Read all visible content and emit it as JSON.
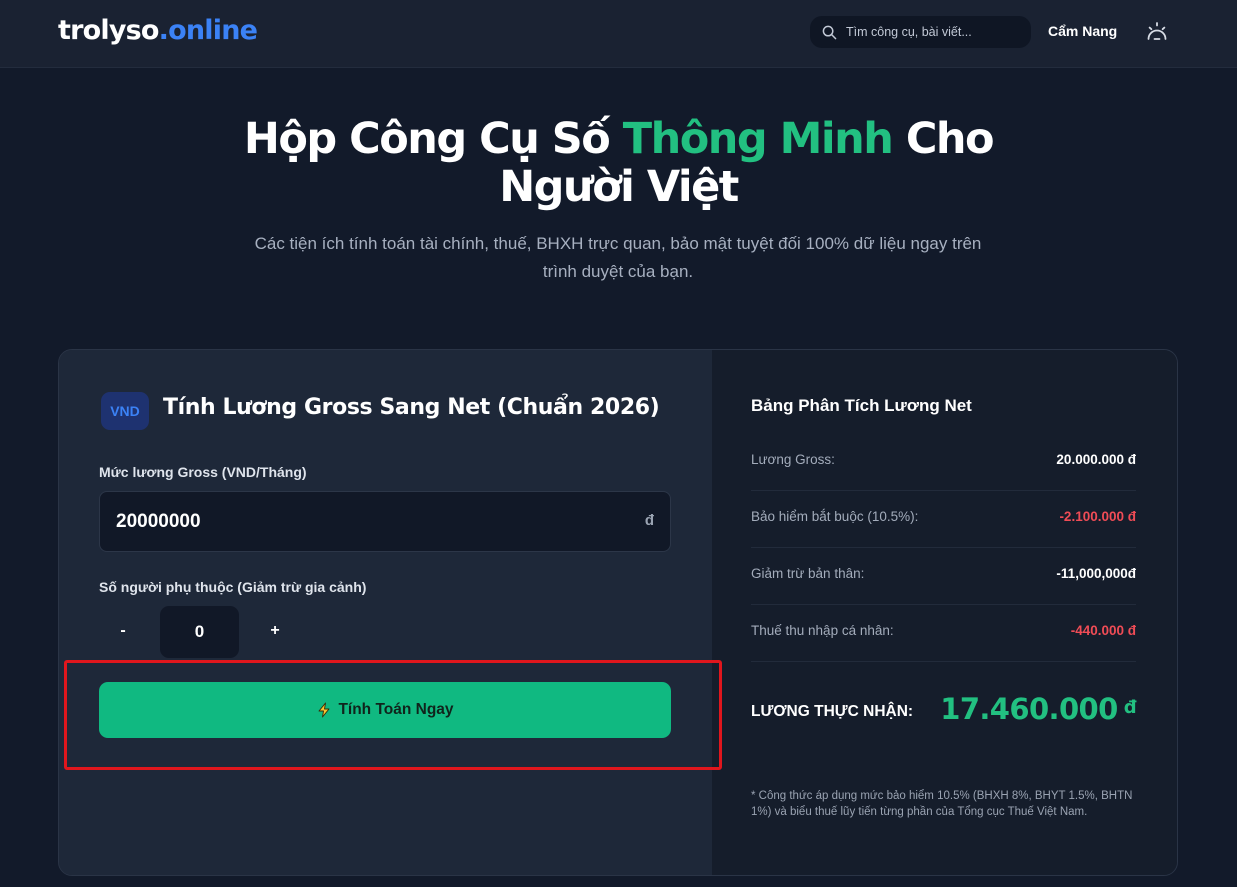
{
  "header": {
    "logo_part1": "trolyso",
    "logo_part2": ".online",
    "search_placeholder": "Tìm công cụ, bài viết...",
    "nav_link": "Cẩm Nang",
    "icons": [
      "search-icon",
      "theme-toggle-icon"
    ]
  },
  "hero": {
    "title_part1": "Hộp Công Cụ Số ",
    "title_highlight": "Thông Minh",
    "title_part2": " Cho",
    "title_line2": "Người Việt",
    "subtitle_line1": "Các tiện ích tính toán tài chính, thuế, BHXH trực quan, bảo mật tuyệt đối 100% dữ liệu ngay trên",
    "subtitle_line2": "trình duyệt của bạn."
  },
  "calculator": {
    "badge": "VND",
    "title": "Tính Lương Gross Sang Net (Chuẩn 2026)",
    "gross_label": "Mức lương Gross (VND/Tháng)",
    "gross_value": "20000000",
    "currency_symbol": "đ",
    "dependents_label": "Số người phụ thuộc (Giảm trừ gia cảnh)",
    "minus_label": "-",
    "dependents_value": "0",
    "plus_label": "+",
    "calculate_button": "Tính Toán Ngay"
  },
  "breakdown": {
    "title": "Bảng Phân Tích Lương Net",
    "rows": [
      {
        "label": "Lương Gross:",
        "value": "20.000.000 đ",
        "tone": "white"
      },
      {
        "label": "Bảo hiểm bắt buộc (10.5%):",
        "value": "-2.100.000 đ",
        "tone": "red"
      },
      {
        "label": "Giảm trừ bản thân:",
        "value": "-11,000,000đ",
        "tone": "white"
      },
      {
        "label": "Thuế thu nhập cá nhân:",
        "value": "-440.000 đ",
        "tone": "red"
      }
    ],
    "net_label": "LƯƠNG THỰC NHẬN:",
    "net_value": "17.460.000",
    "net_currency": "đ",
    "footnote": "* Công thức áp dụng mức bảo hiểm 10.5% (BHXH 8%, BHYT 1.5%, BHTN 1%) và biểu thuế lũy tiến từng phần của Tổng cục Thuế Việt Nam."
  },
  "colors": {
    "background": "#121a2a",
    "accent_green": "#10b981",
    "highlight_green": "#22c081",
    "brand_blue": "#3b82f6",
    "negative_red": "#f04c56",
    "annotation_red": "#e0161d"
  }
}
